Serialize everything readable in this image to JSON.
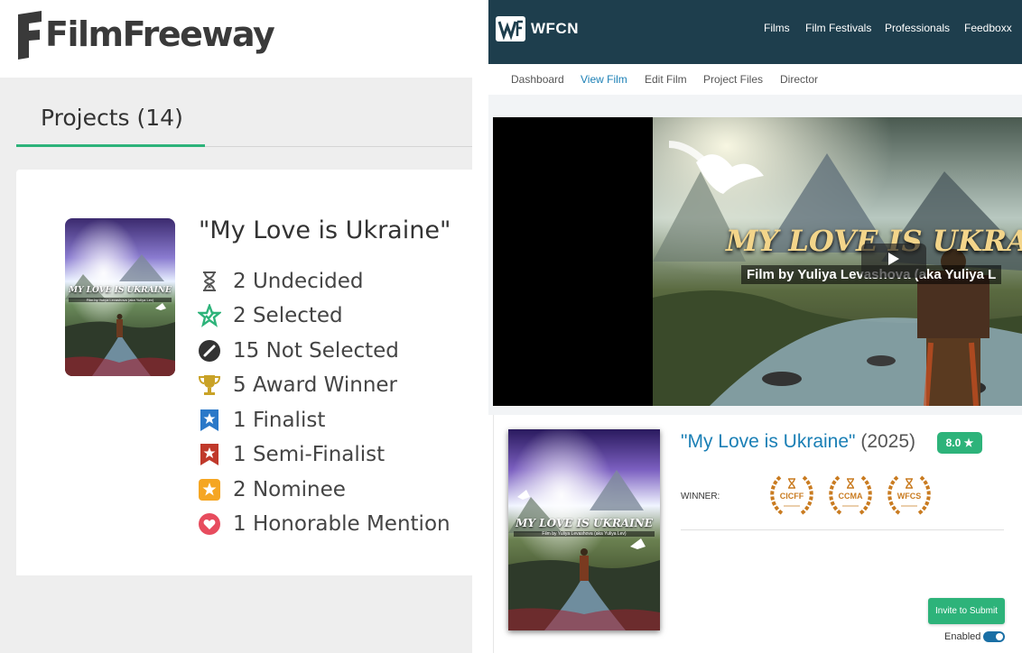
{
  "filmfreeway": {
    "logo_text": "FilmFreeway",
    "tab_label": "Projects (14)",
    "project": {
      "title": "\"My Love is Ukraine\"",
      "poster_title": "MY LOVE IS UKRAINE",
      "poster_credit": "Film by Yuliya Levashova (aka Yuliya Lev)",
      "statuses": [
        {
          "icon": "hourglass-icon",
          "label": "2 Undecided",
          "color": "#555555"
        },
        {
          "icon": "selected-star-icon",
          "label": "2 Selected",
          "color": "#2db37a"
        },
        {
          "icon": "not-selected-icon",
          "label": "15 Not Selected",
          "color": "#333333"
        },
        {
          "icon": "trophy-icon",
          "label": "5 Award Winner",
          "color": "#c9a227"
        },
        {
          "icon": "finalist-ribbon-icon",
          "label": "1 Finalist",
          "color": "#2a78c8"
        },
        {
          "icon": "semifinalist-ribbon-icon",
          "label": "1 Semi-Finalist",
          "color": "#c0392b"
        },
        {
          "icon": "nominee-star-icon",
          "label": "2 Nominee",
          "color": "#f5a623"
        },
        {
          "icon": "heart-icon",
          "label": "1 Honorable Mention",
          "color": "#e74c5e"
        }
      ]
    }
  },
  "wfcn": {
    "logo_text": "WFCN",
    "nav": [
      "Films",
      "Film Festivals",
      "Professionals",
      "Feedboxx"
    ],
    "subnav": [
      "Dashboard",
      "View Film",
      "Edit Film",
      "Project Files",
      "Director"
    ],
    "active_subnav": "View Film",
    "video": {
      "title": "MY LOVE IS UKRAIN",
      "credit": "Film by Yuliya Levashova (aka Yuliya L"
    },
    "film": {
      "title": "\"My Love is Ukraine\"",
      "year": "(2025)",
      "rating": "8.0 ★",
      "winner_label": "WINNER:",
      "laurels": [
        "CICFF",
        "CCMA",
        "WFCS"
      ]
    },
    "invite_button": "Invite to Submit",
    "enabled_label": "Enabled",
    "enabled": true
  }
}
